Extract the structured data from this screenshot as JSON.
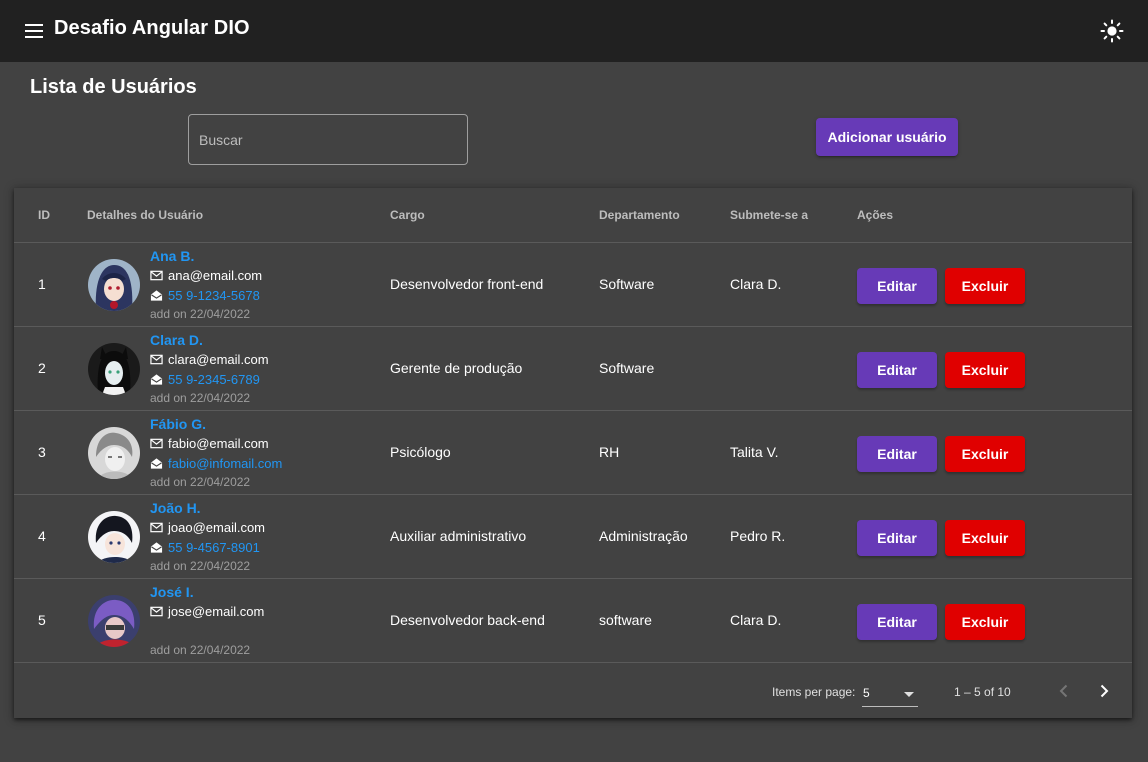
{
  "toolbar": {
    "title": "Desafio Angular DIO",
    "menu_icon": "menu-icon",
    "theme_icon": "sun-icon"
  },
  "page": {
    "title": "Lista de Usuários"
  },
  "search": {
    "placeholder": "Buscar",
    "value": ""
  },
  "add_button": {
    "label": "Adicionar usuário"
  },
  "table": {
    "headers": {
      "id": "ID",
      "details": "Detalhes do Usuário",
      "cargo": "Cargo",
      "dept": "Departamento",
      "reports": "Submete-se a",
      "actions": "Ações"
    },
    "edit_label": "Editar",
    "delete_label": "Excluir",
    "rows": [
      {
        "id": "1",
        "name": "Ana B.",
        "email": "ana@email.com",
        "contact": "55 9-1234-5678",
        "added": "add on 22/04/2022",
        "cargo": "Desenvolvedor front-end",
        "dept": "Software",
        "reports": "Clara D."
      },
      {
        "id": "2",
        "name": "Clara D.",
        "email": "clara@email.com",
        "contact": "55 9-2345-6789",
        "added": "add on 22/04/2022",
        "cargo": "Gerente de produção",
        "dept": "Software",
        "reports": ""
      },
      {
        "id": "3",
        "name": "Fábio G.",
        "email": "fabio@email.com",
        "contact": "fabio@infomail.com",
        "added": "add on 22/04/2022",
        "cargo": "Psicólogo",
        "dept": "RH",
        "reports": "Talita V."
      },
      {
        "id": "4",
        "name": "João H.",
        "email": "joao@email.com",
        "contact": "55 9-4567-8901",
        "added": "add on 22/04/2022",
        "cargo": "Auxiliar administrativo",
        "dept": "Administração",
        "reports": "Pedro R."
      },
      {
        "id": "5",
        "name": "José I.",
        "email": "jose@email.com",
        "contact": "",
        "added": "add on 22/04/2022",
        "cargo": "Desenvolvedor back-end",
        "dept": "software",
        "reports": "Clara D."
      }
    ]
  },
  "paginator": {
    "items_per_page_label": "Items per page:",
    "page_size": "5",
    "range_label": "1 – 5 of 10"
  },
  "colors": {
    "toolbar_bg": "#212121",
    "page_bg": "#424242",
    "primary": "#673ab7",
    "warn": "#e00000",
    "link": "#2196f3"
  }
}
